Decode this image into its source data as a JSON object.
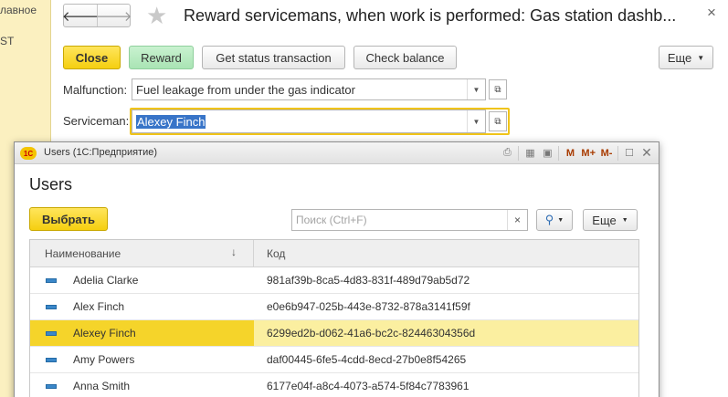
{
  "left_panel": {
    "items": [
      "лавное",
      "ST"
    ]
  },
  "header": {
    "back_glyph": "🡐",
    "forward_glyph": "🡒",
    "star_glyph": "★",
    "title": "Reward servicemans, when work is performed: Gas station dashb...",
    "close_glyph": "×"
  },
  "toolbar": {
    "close_label": "Close",
    "reward_label": "Reward",
    "status_label": "Get status transaction",
    "balance_label": "Check balance",
    "more_label": "Еще"
  },
  "fields": {
    "malfunction_label": "Malfunction:",
    "malfunction_value": "Fuel leakage from under the gas indicator",
    "serviceman_label": "Serviceman:",
    "serviceman_value": "Alexey Finch"
  },
  "popup": {
    "window_title": "Users  (1С:Предприятие)",
    "heading": "Users",
    "select_label": "Выбрать",
    "search_placeholder": "Поиск (Ctrl+F)",
    "more_label": "Еще",
    "toolbar_icons": [
      "print-icon",
      "table-icon",
      "calendar-icon",
      "M",
      "M+",
      "M-",
      "maximize-icon",
      "close-icon"
    ],
    "columns": [
      "Наименование",
      "Код"
    ],
    "rows": [
      {
        "name": "Adelia Clarke",
        "code": "981af39b-8ca5-4d83-831f-489d79ab5d72"
      },
      {
        "name": "Alex Finch",
        "code": "e0e6b947-025b-443e-8732-878a3141f59f"
      },
      {
        "name": "Alexey Finch",
        "code": "6299ed2b-d062-41a6-bc2c-82446304356d"
      },
      {
        "name": "Amy Powers",
        "code": "daf00445-6fe5-4cdd-8ecd-27b0e8f54265"
      },
      {
        "name": "Anna Smith",
        "code": "6177e04f-a8c4-4073-a574-5f84c7783961"
      }
    ],
    "selected_row": 2
  },
  "colors": {
    "accent_yellow": "#f5cf10",
    "accent_green": "#a9e4b4",
    "selection_blue": "#3874c8",
    "row_highlight": "#fbefa0"
  }
}
